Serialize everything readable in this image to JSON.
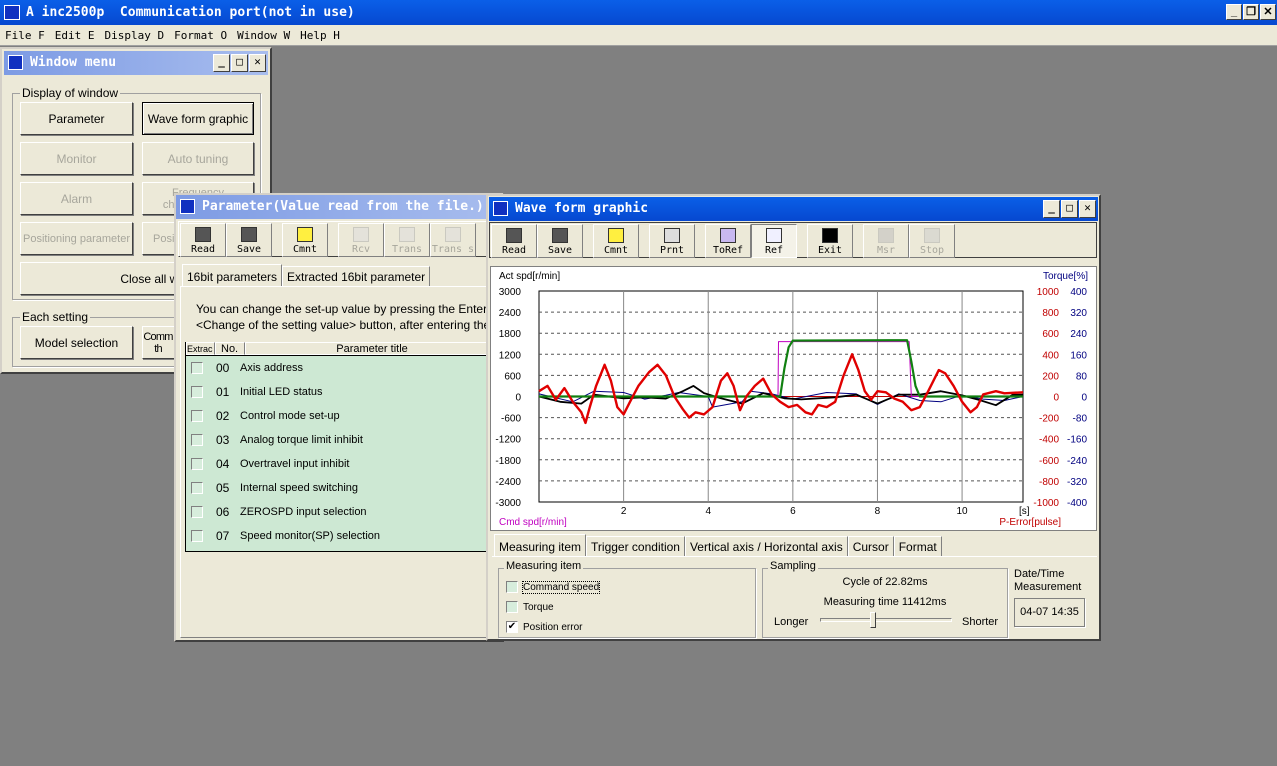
{
  "app": {
    "title": "A inc2500p  Communication port(not in use)",
    "menu": [
      "File F",
      "Edit E",
      "Display D",
      "Format O",
      "Window W",
      "Help H"
    ]
  },
  "window_menu": {
    "title": "Window menu",
    "display_group": "Display of window",
    "buttons": [
      {
        "label": "Parameter",
        "enabled": true
      },
      {
        "label": "Wave form graphic",
        "enabled": true,
        "focused": true
      },
      {
        "label": "Monitor",
        "enabled": false
      },
      {
        "label": "Auto tuning",
        "enabled": false
      },
      {
        "label": "Alarm",
        "enabled": false
      },
      {
        "label": "Frequency characteristics",
        "enabled": false
      },
      {
        "label": "Positioning parameter",
        "enabled": false
      },
      {
        "label": "Posit",
        "enabled": false
      }
    ],
    "close_all": "Close all windows",
    "each_group": "Each setting",
    "model_selection": "Model selection",
    "comm_button": "Comm th"
  },
  "parameter": {
    "title": "Parameter(Value read from the file.)",
    "toolbar": [
      {
        "label": "Read",
        "icon": "floppy-icon"
      },
      {
        "label": "Save",
        "icon": "floppy-icon"
      },
      {
        "label": "Cmnt",
        "icon": "note-icon"
      },
      {
        "label": "Rcv",
        "icon": "receive-icon",
        "disabled": true
      },
      {
        "label": "Trans",
        "icon": "transmit-icon",
        "disabled": true
      },
      {
        "label": "Trans s",
        "icon": "transmit-icon",
        "disabled": true
      }
    ],
    "tabs": [
      "16bit parameters",
      "Extracted 16bit parameter"
    ],
    "info_line1": "You can change the set-up value by pressing the Enter key or the",
    "info_line2": "<Change of the setting value> button, after entering the value.",
    "columns": [
      "Extrac",
      "No.",
      "Parameter title"
    ],
    "rows": [
      {
        "no": "00",
        "title": "Axis address"
      },
      {
        "no": "01",
        "title": "Initial LED status"
      },
      {
        "no": "02",
        "title": "Control mode set-up"
      },
      {
        "no": "03",
        "title": "Analog torque limit inhibit"
      },
      {
        "no": "04",
        "title": "Overtravel input inhibit"
      },
      {
        "no": "05",
        "title": "Internal speed switching"
      },
      {
        "no": "06",
        "title": "ZEROSPD input selection"
      },
      {
        "no": "07",
        "title": "Speed monitor(SP) selection"
      }
    ]
  },
  "wave": {
    "title": "Wave form graphic",
    "toolbar": [
      {
        "label": "Read",
        "icon": "floppy-icon"
      },
      {
        "label": "Save",
        "icon": "floppy-icon"
      },
      {
        "label": "Cmnt",
        "icon": "note-icon"
      },
      {
        "label": "Prnt",
        "icon": "printer-icon"
      },
      {
        "label": "ToRef",
        "icon": "to-reference-icon"
      },
      {
        "label": "Ref",
        "icon": "reference-icon",
        "pressed": true
      },
      {
        "label": "Exit",
        "icon": "exit-icon"
      },
      {
        "label": "Msr",
        "icon": "measure-icon",
        "disabled": true
      },
      {
        "label": "Stop",
        "icon": "stop-icon",
        "disabled": true
      }
    ],
    "tabs": [
      "Measuring item",
      "Trigger condition",
      "Vertical axis / Horizontal axis",
      "Cursor",
      "Format"
    ],
    "measuring_group": "Measuring item",
    "items": [
      {
        "label": "Command speed",
        "checked": false
      },
      {
        "label": "Torque",
        "checked": false
      },
      {
        "label": "Position error",
        "checked": true
      }
    ],
    "sampling_group": "Sampling",
    "cycle": "Cycle of 22.82ms",
    "measuring_time": "Measuring time 11412ms",
    "longer": "Longer",
    "shorter": "Shorter",
    "slider_position": 0.4,
    "datetime_label1": "Date/Time",
    "datetime_label2": "Measurement",
    "datetime": "04-07 14:35"
  },
  "chart_data": {
    "type": "line",
    "labels": {
      "left_top": "Act spd[r/min]",
      "left_bottom": "Cmd spd[r/min]",
      "right_top": "Torque[%]",
      "right_bottom": "P-Error[pulse]",
      "x_unit": "[s]"
    },
    "colors": {
      "speed_axis": "#000000",
      "cmd_label": "#c000c0",
      "pulse_axis": "#c00000",
      "torque_axis": "#000080"
    },
    "xlim": [
      0,
      11.44
    ],
    "xticks": [
      2,
      4,
      6,
      8,
      10
    ],
    "speed_lim": [
      -3000,
      3000
    ],
    "speed_ticks": [
      3000,
      2400,
      1800,
      1200,
      600,
      0,
      -600,
      -1200,
      -1800,
      -2400,
      -3000
    ],
    "pulse_lim": [
      -1000,
      1000
    ],
    "pulse_ticks": [
      1000,
      800,
      600,
      400,
      200,
      0,
      -200,
      -400,
      -600,
      -800,
      -1000
    ],
    "torque_lim": [
      -400,
      400
    ],
    "torque_ticks": [
      400,
      320,
      240,
      160,
      80,
      0,
      -80,
      -160,
      -240,
      -320,
      -400
    ],
    "grid": true,
    "series": [
      {
        "axis": "torque",
        "color": "#000080",
        "width": 1,
        "points": [
          [
            0,
            10
          ],
          [
            0.8,
            -20
          ],
          [
            1.3,
            20
          ],
          [
            2,
            15
          ],
          [
            2.5,
            -10
          ],
          [
            3,
            5
          ],
          [
            3.3,
            15
          ],
          [
            4,
            0
          ],
          [
            4.1,
            -40
          ],
          [
            4.8,
            -20
          ],
          [
            5,
            20
          ],
          [
            5.5,
            10
          ],
          [
            6,
            -10
          ],
          [
            6.8,
            15
          ],
          [
            7.5,
            10
          ],
          [
            8,
            -30
          ],
          [
            8.5,
            10
          ],
          [
            9,
            -15
          ],
          [
            9.5,
            -20
          ],
          [
            10,
            5
          ],
          [
            10.5,
            -10
          ],
          [
            11,
            -15
          ],
          [
            11.44,
            0
          ]
        ]
      },
      {
        "axis": "torque",
        "color": "#000000",
        "width": 1.8,
        "points": [
          [
            0,
            0
          ],
          [
            0.5,
            -20
          ],
          [
            1,
            -27
          ],
          [
            1.3,
            7
          ],
          [
            2,
            -7
          ],
          [
            2.5,
            -3
          ],
          [
            3,
            -8
          ],
          [
            3.4,
            20
          ],
          [
            3.65,
            40
          ],
          [
            3.9,
            13
          ],
          [
            4.3,
            -7
          ],
          [
            4.8,
            -27
          ],
          [
            5.3,
            13
          ],
          [
            5.8,
            -7
          ],
          [
            6.2,
            -11
          ],
          [
            7,
            -3
          ],
          [
            7.5,
            7
          ],
          [
            8,
            -27
          ],
          [
            8.5,
            7
          ],
          [
            9,
            7
          ],
          [
            9.5,
            20
          ],
          [
            10,
            4
          ],
          [
            10.4,
            -13
          ],
          [
            10.8,
            -33
          ],
          [
            11.2,
            7
          ],
          [
            11.44,
            7
          ]
        ]
      },
      {
        "axis": "speed",
        "color": "#c000c0",
        "width": 1,
        "points": [
          [
            0,
            0
          ],
          [
            5.65,
            0
          ],
          [
            5.66,
            1560
          ],
          [
            8.75,
            1560
          ],
          [
            8.8,
            0
          ],
          [
            11.44,
            0
          ]
        ]
      },
      {
        "axis": "speed",
        "color": "#108010",
        "width": 2.2,
        "points": [
          [
            0,
            0
          ],
          [
            5.7,
            0
          ],
          [
            5.8,
            800
          ],
          [
            5.9,
            1400
          ],
          [
            6,
            1590
          ],
          [
            8.7,
            1600
          ],
          [
            8.8,
            1000
          ],
          [
            8.9,
            300
          ],
          [
            9,
            0
          ],
          [
            11.44,
            0
          ]
        ]
      },
      {
        "axis": "pulse",
        "color": "#e00000",
        "width": 2.4,
        "points": [
          [
            0,
            50
          ],
          [
            0.2,
            100
          ],
          [
            0.4,
            -30
          ],
          [
            0.6,
            80
          ],
          [
            0.8,
            -50
          ],
          [
            1,
            -150
          ],
          [
            1.1,
            -250
          ],
          [
            1.2,
            -100
          ],
          [
            1.35,
            100
          ],
          [
            1.55,
            300
          ],
          [
            1.7,
            150
          ],
          [
            1.85,
            -100
          ],
          [
            2,
            -170
          ],
          [
            2.15,
            -50
          ],
          [
            2.35,
            100
          ],
          [
            2.6,
            230
          ],
          [
            2.8,
            300
          ],
          [
            3,
            200
          ],
          [
            3.2,
            0
          ],
          [
            3.4,
            -120
          ],
          [
            3.55,
            -200
          ],
          [
            3.7,
            -150
          ],
          [
            3.9,
            -170
          ],
          [
            4.1,
            -100
          ],
          [
            4.3,
            150
          ],
          [
            4.45,
            220
          ],
          [
            4.6,
            100
          ],
          [
            4.75,
            -130
          ],
          [
            4.9,
            0
          ],
          [
            5.1,
            100
          ],
          [
            5.3,
            170
          ],
          [
            5.5,
            20
          ],
          [
            5.7,
            -50
          ],
          [
            5.9,
            -100
          ],
          [
            6.1,
            -80
          ],
          [
            6.3,
            -150
          ],
          [
            6.45,
            -170
          ],
          [
            6.6,
            -80
          ],
          [
            6.8,
            -100
          ],
          [
            7,
            -50
          ],
          [
            7.2,
            200
          ],
          [
            7.4,
            400
          ],
          [
            7.55,
            250
          ],
          [
            7.7,
            50
          ],
          [
            7.85,
            -30
          ],
          [
            8,
            50
          ],
          [
            8.2,
            40
          ],
          [
            8.4,
            -20
          ],
          [
            8.6,
            -50
          ],
          [
            8.8,
            -130
          ],
          [
            9,
            -100
          ],
          [
            9.2,
            50
          ],
          [
            9.45,
            250
          ],
          [
            9.6,
            220
          ],
          [
            9.8,
            100
          ],
          [
            10,
            -50
          ],
          [
            10.2,
            -150
          ],
          [
            10.35,
            -100
          ],
          [
            10.5,
            20
          ],
          [
            10.8,
            50
          ],
          [
            11,
            30
          ],
          [
            11.44,
            40
          ]
        ]
      }
    ]
  }
}
